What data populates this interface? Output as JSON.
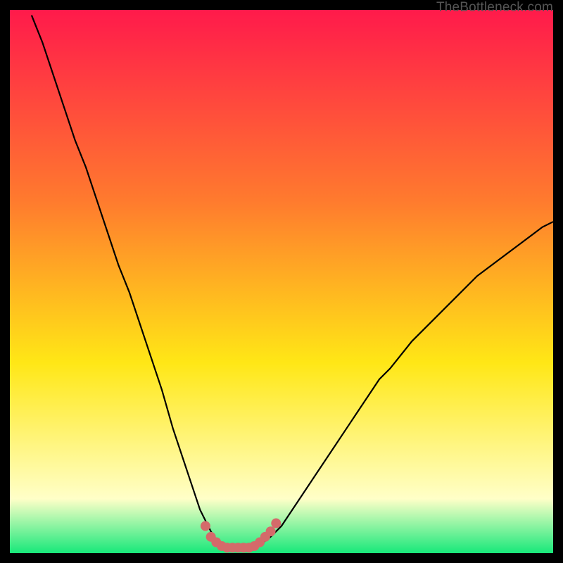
{
  "watermark": "TheBottleneck.com",
  "colors": {
    "gradient_top": "#ff1a4b",
    "gradient_mid1": "#ff7a2e",
    "gradient_mid2": "#ffe716",
    "gradient_pale": "#ffffc8",
    "gradient_bottom": "#17e87a",
    "curve": "#000000",
    "markers": "#d46a6a",
    "frame_bg": "#000000"
  },
  "chart_data": {
    "type": "line",
    "title": "",
    "xlabel": "",
    "ylabel": "",
    "xlim": [
      0,
      100
    ],
    "ylim": [
      0,
      100
    ],
    "grid": false,
    "legend": false,
    "series": [
      {
        "name": "bottleneck-curve",
        "x": [
          4,
          6,
          8,
          10,
          12,
          14,
          16,
          18,
          20,
          22,
          24,
          26,
          28,
          30,
          31,
          32,
          33,
          34,
          35,
          36,
          37,
          38,
          39,
          40,
          41,
          42,
          43,
          44,
          46,
          48,
          50,
          52,
          54,
          56,
          58,
          60,
          62,
          64,
          66,
          68,
          70,
          74,
          78,
          82,
          86,
          90,
          94,
          98,
          100
        ],
        "y": [
          99,
          94,
          88,
          82,
          76,
          71,
          65,
          59,
          53,
          48,
          42,
          36,
          30,
          23,
          20,
          17,
          14,
          11,
          8,
          6,
          4,
          2.5,
          1.5,
          1,
          1,
          1,
          1,
          1,
          1.5,
          3,
          5,
          8,
          11,
          14,
          17,
          20,
          23,
          26,
          29,
          32,
          34,
          39,
          43,
          47,
          51,
          54,
          57,
          60,
          61
        ]
      }
    ],
    "annotations": [
      {
        "name": "trough-markers",
        "type": "scatter",
        "x": [
          36,
          37,
          38,
          39,
          40,
          41,
          42,
          43,
          44,
          45,
          46,
          47,
          48,
          49
        ],
        "y": [
          5,
          3,
          2,
          1.3,
          1,
          1,
          1,
          1,
          1,
          1.3,
          2,
          3,
          4,
          5.5
        ]
      }
    ]
  }
}
